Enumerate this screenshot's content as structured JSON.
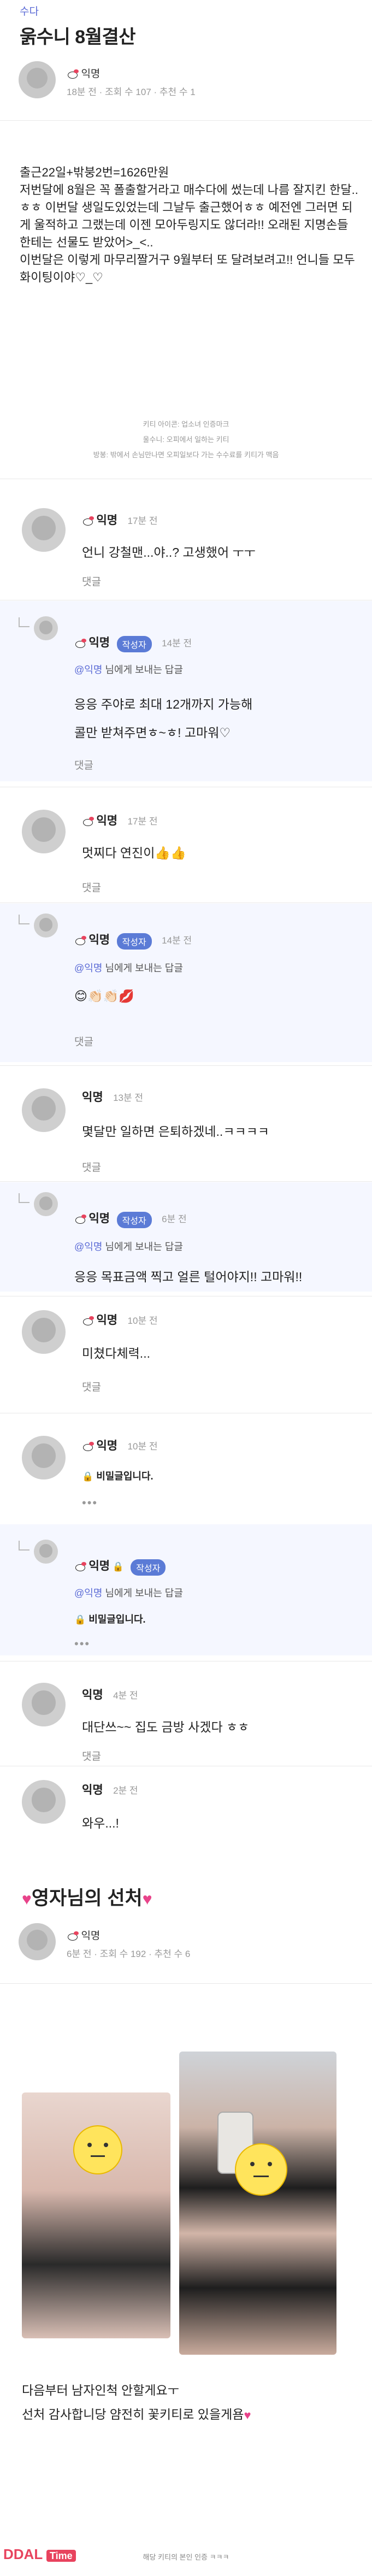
{
  "post": {
    "category": "수다",
    "title": "욹수니 8월결산",
    "author": "익명",
    "time": "18분 전",
    "views": "조회 수 107",
    "likes": "추천 수 1",
    "body": "출근22일+밖붕2번=1626만원\n저번달에 8월은 꼭 폴출할거라고 매수다에 썼는데 나름 잘지킨 한달..ㅎㅎ 이번달 생일도있었는데 그날두 출근했어ㅎㅎ 예전엔 그러면 되게 울적하고 그랬는데 이젠 모아두링지도 않더라!! 오래된 지명손들 한테는 선물도 받았어>_<..\n이번달은 이렇게 마무리짤거구 9월부터 또 달려보려고!! 언니들 모두 화이팅이야♡_♡",
    "notice_line1": "키티 아이콘: 업소녀 인증마크",
    "notice_line2": "울수니: 오피에서 일하는 키티",
    "notice_line3": "방봉: 밖에서 손님만나면 오피일보다 가는 수수료를 키티가 맥음"
  },
  "comments": [
    {
      "name": "익명",
      "time": "17분 전",
      "text": "언니 강철맨...야..? 고생했어 ㅜㅜ",
      "reply": "댓글"
    },
    {
      "name": "익명",
      "badge": "작성자",
      "time": "14분 전",
      "quote_target": "@익명",
      "quote_rest": " 님에게 보내는 답글",
      "text1": "응응 주야로 최대 12개까지 가능해",
      "text2": "콜만 받쳐주면ㅎ~ㅎ! 고마워♡",
      "reply": "댓글"
    },
    {
      "name": "익명",
      "time": "17분 전",
      "text": "멋찌다 연진이👍👍",
      "reply": "댓글"
    },
    {
      "name": "익명",
      "badge": "작성자",
      "time": "14분 전",
      "quote_target": "@익명",
      "quote_rest": " 님에게 보내는 답글",
      "text": "😊👏🏻👏🏻💋",
      "reply": "댓글"
    },
    {
      "name": "익명",
      "time": "13분 전",
      "text": "몇달만 일하면 은퇴하겠네..ㅋㅋㅋㅋ",
      "reply": "댓글"
    },
    {
      "name": "익명",
      "badge": "작성자",
      "time": "6분 전",
      "quote_target": "@익명",
      "quote_rest": " 님에게 보내는 답글",
      "text": "응응 목표금액 찍고 얼른 털어야지!! 고마워!!"
    },
    {
      "name": "익명",
      "time": "10분 전",
      "text": "미쳤다체력...",
      "reply": "댓글"
    },
    {
      "name": "익명",
      "time": "10분 전",
      "text": "비밀글입니다.",
      "more": "•••"
    },
    {
      "name": "익명",
      "badge": "작성자",
      "time": "",
      "quote_target": "@익명",
      "quote_rest": " 님에게 보내는 답글",
      "text": "비밀글입니다.",
      "more": "•••"
    },
    {
      "name": "익명",
      "time": "4분 전",
      "text": "대단쓰~~ 집도 금방 사겠다 ㅎㅎ",
      "reply": "댓글"
    },
    {
      "name": "익명",
      "time": "2분 전",
      "text": "와우...!"
    }
  ],
  "second_post": {
    "title": "영자님의 선처",
    "author": "익명",
    "time": "6분 전",
    "views": "조회 수 192",
    "likes": "추천 수 6",
    "body_line1": "다음부터 남자인척 안할게요ㅜ",
    "body_line2": "선처 감사합니당 얌전히 꽃키티로 있을게욤",
    "footer": "해당 키티의 본인 인증 ㅋㅋㅋ"
  },
  "watermark": {
    "brand": "DDAL",
    "tag": "Time"
  },
  "colors": {
    "accent": "#5b6bd6",
    "badge": "#5b7bd6",
    "heart": "#e8438a",
    "reply_bg": "#f5f7ff"
  }
}
